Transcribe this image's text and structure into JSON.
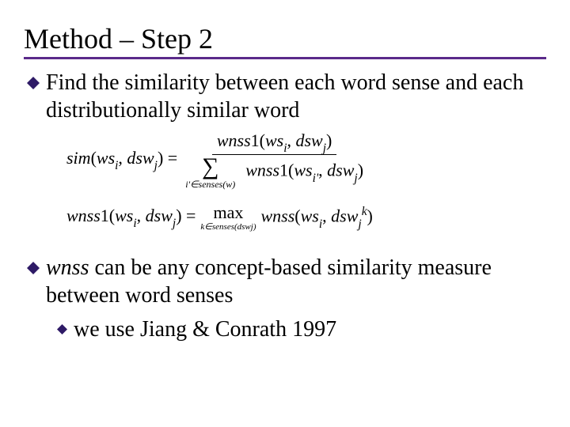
{
  "title": "Method – Step 2",
  "bullets": {
    "b1": "Find the similarity between each word sense and each distributionally similar word",
    "b2_lead_italic": "wnss",
    "b2_rest": " can be any concept-based similarity measure between word senses",
    "b2_sub": "we use Jiang & Conrath 1997"
  },
  "equations": {
    "eq1": {
      "lhs_func": "sim",
      "lhs_arg1_base": "ws",
      "lhs_arg1_sub": "i",
      "lhs_arg2_base": "dsw",
      "lhs_arg2_sub": "j",
      "num_func": "wnss",
      "num_sup": "1",
      "num_arg1_base": "ws",
      "num_arg1_sub": "i",
      "num_arg2_base": "dsw",
      "num_arg2_sub": "j",
      "sum_limit": "i'∈senses(w)",
      "den_func": "wnss",
      "den_sup": "1",
      "den_arg1_base": "ws",
      "den_arg1_sub": "i'",
      "den_arg2_base": "dsw",
      "den_arg2_sub": "j"
    },
    "eq2": {
      "lhs_func": "wnss",
      "lhs_sup": "1",
      "lhs_arg1_base": "ws",
      "lhs_arg1_sub": "i",
      "lhs_arg2_base": "dsw",
      "lhs_arg2_sub": "j",
      "max_label": "max",
      "max_limit": "k∈senses(dswj)",
      "rhs_func": "wnss",
      "rhs_arg1_base": "ws",
      "rhs_arg1_sub": "i",
      "rhs_arg2_base": "dsw",
      "rhs_arg2_sub": "j",
      "rhs_arg2_sup": "k"
    }
  },
  "colors": {
    "accent": "#5a2a8a",
    "bullet": "#2e1a66"
  }
}
